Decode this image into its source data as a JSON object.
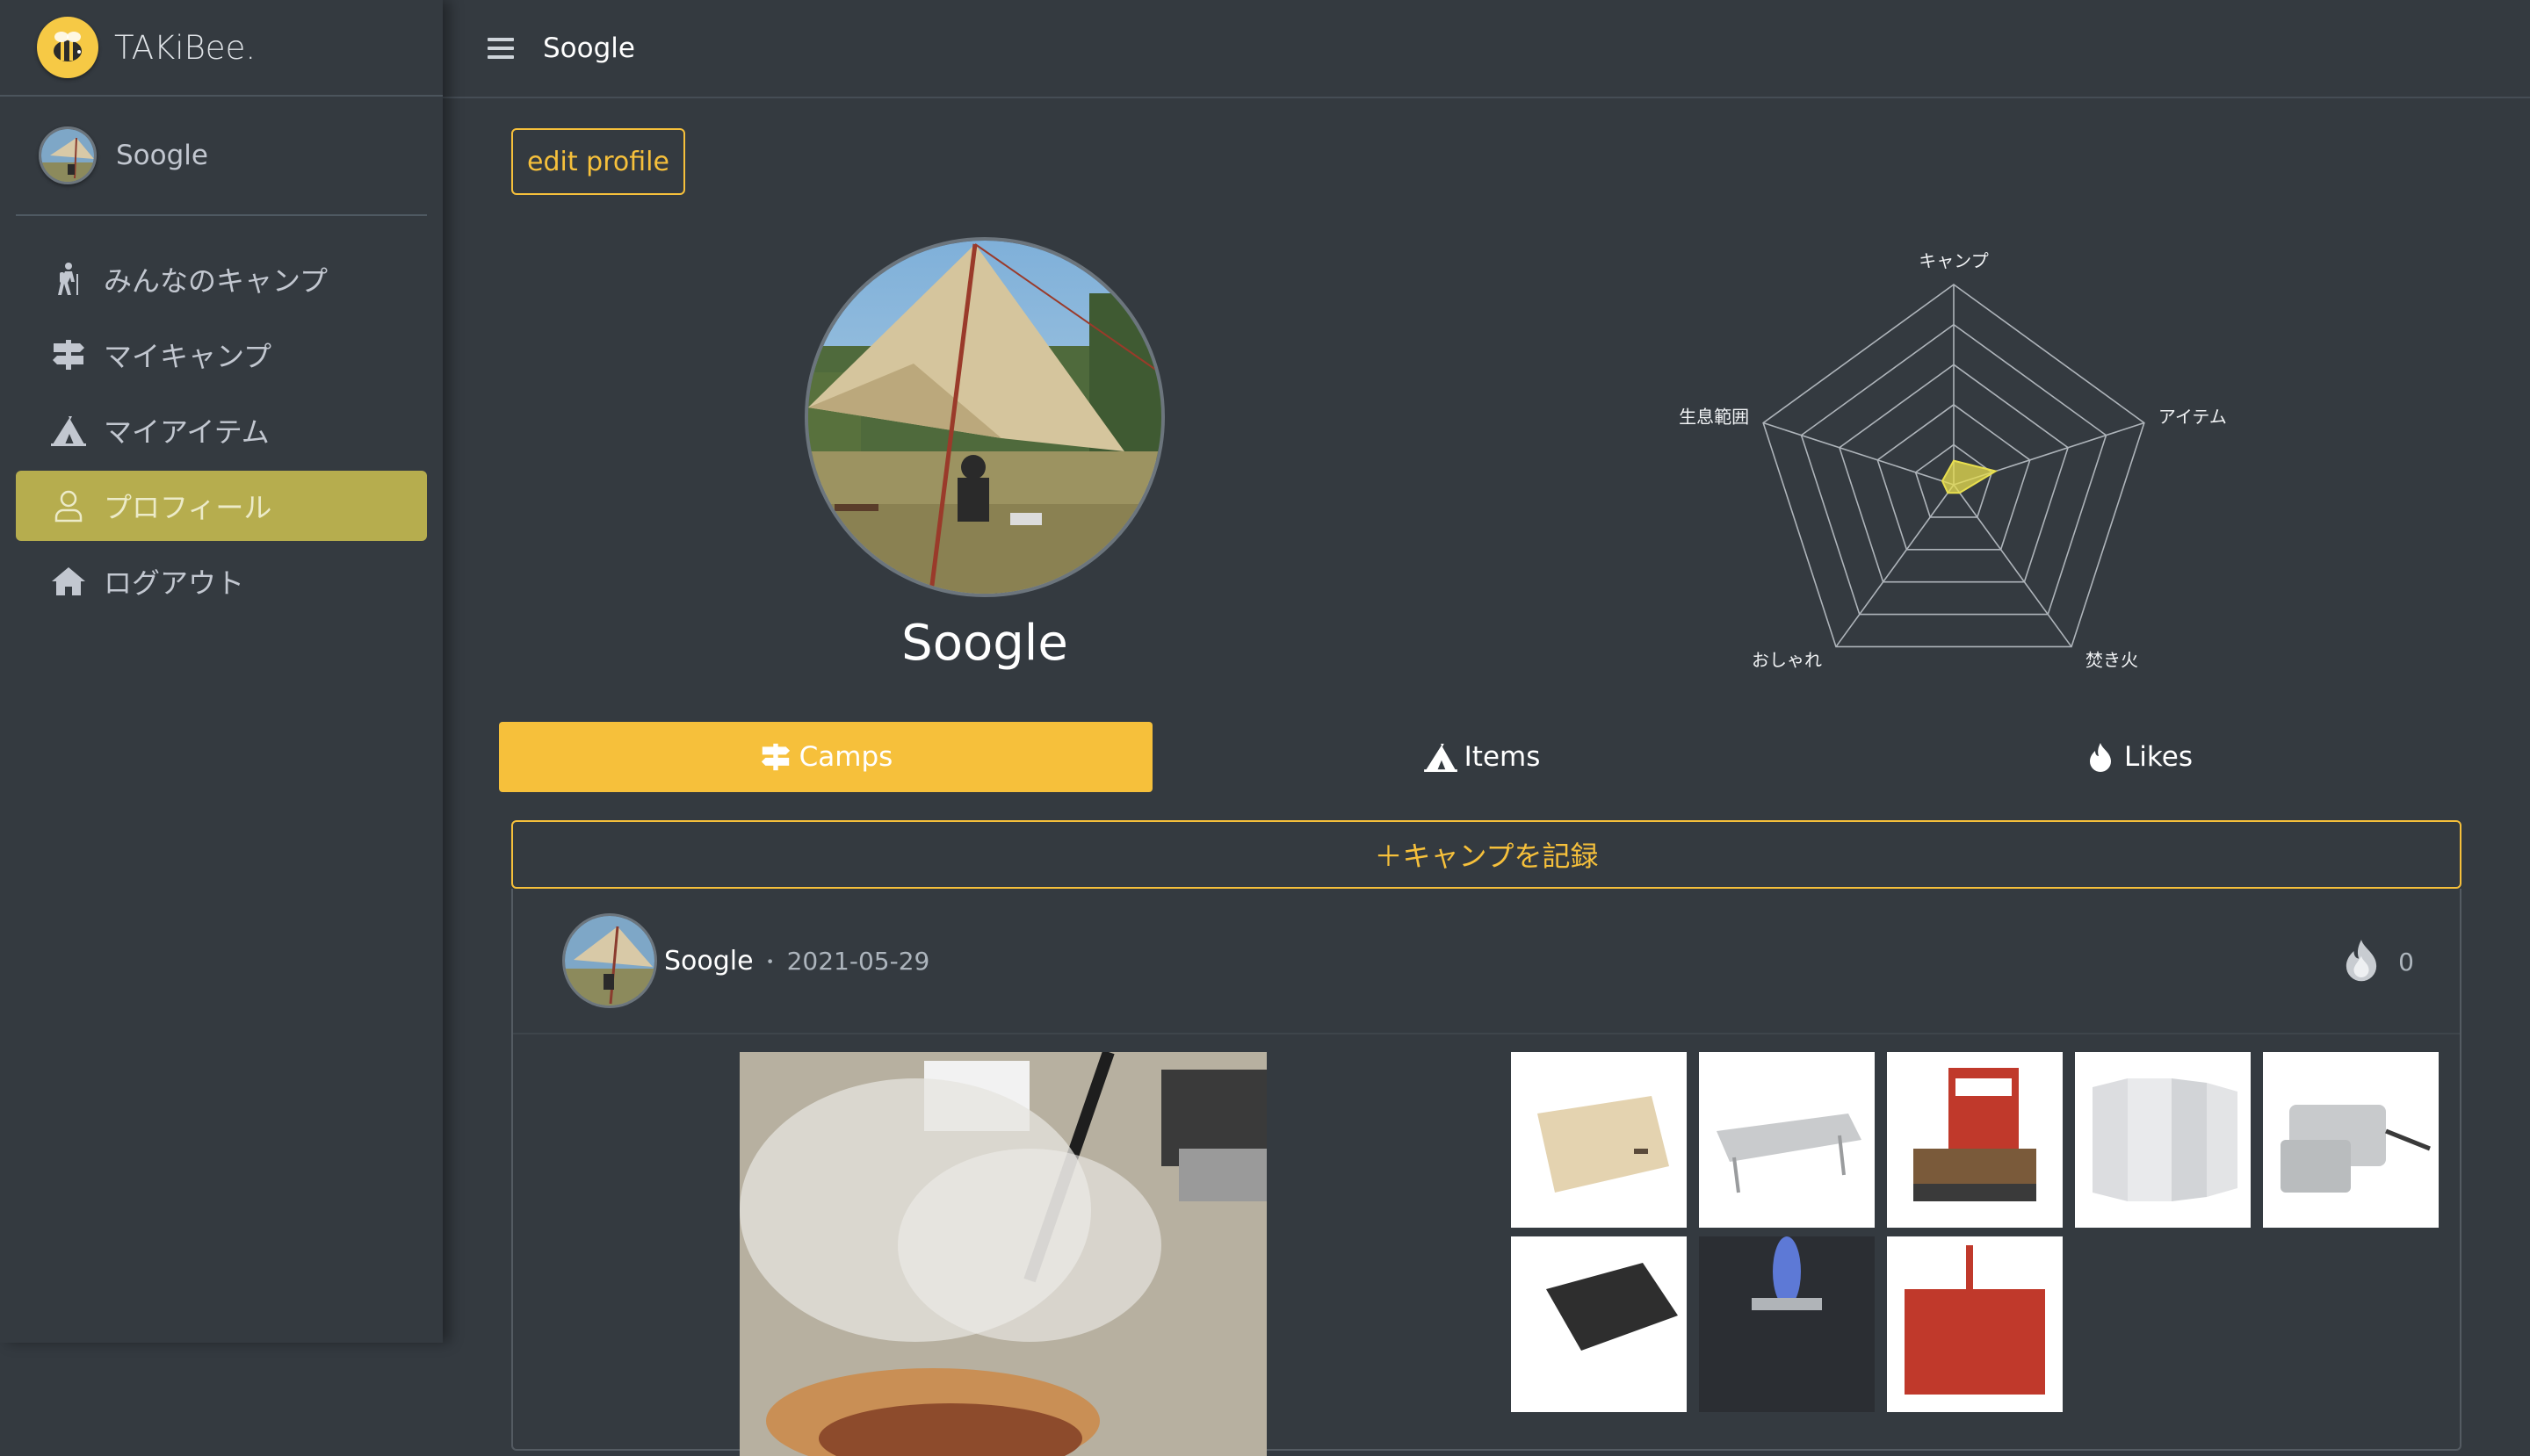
{
  "brand": {
    "name": "TAKiBee."
  },
  "sidebar": {
    "user_name": "Soogle",
    "items": [
      {
        "label": "みんなのキャンプ",
        "icon": "hiking-icon"
      },
      {
        "label": "マイキャンプ",
        "icon": "signpost-icon"
      },
      {
        "label": "マイアイテム",
        "icon": "tent-icon"
      },
      {
        "label": "プロフィール",
        "icon": "user-icon",
        "active": true
      },
      {
        "label": "ログアウト",
        "icon": "home-icon"
      }
    ]
  },
  "header": {
    "title": "Soogle"
  },
  "profile": {
    "edit_label": "edit profile",
    "name": "Soogle"
  },
  "radar": {
    "axes": [
      "キャンプ",
      "アイテム",
      "焚き火",
      "おしゃれ",
      "生息範囲"
    ],
    "levels": 5,
    "values": [
      0.12,
      0.22,
      0.05,
      0.05,
      0.06
    ],
    "fill_color": "#e8df4f"
  },
  "tabs": {
    "camps": "Camps",
    "items": "Items",
    "likes": "Likes"
  },
  "record_button": "＋キャンプを記録",
  "camp_card": {
    "user": "Soogle",
    "separator": "・",
    "date": "2021-05-29",
    "like_count": "0"
  },
  "colors": {
    "accent": "#f6c03b",
    "sidebar_active": "#b6ad4e",
    "background": "#343a40"
  }
}
